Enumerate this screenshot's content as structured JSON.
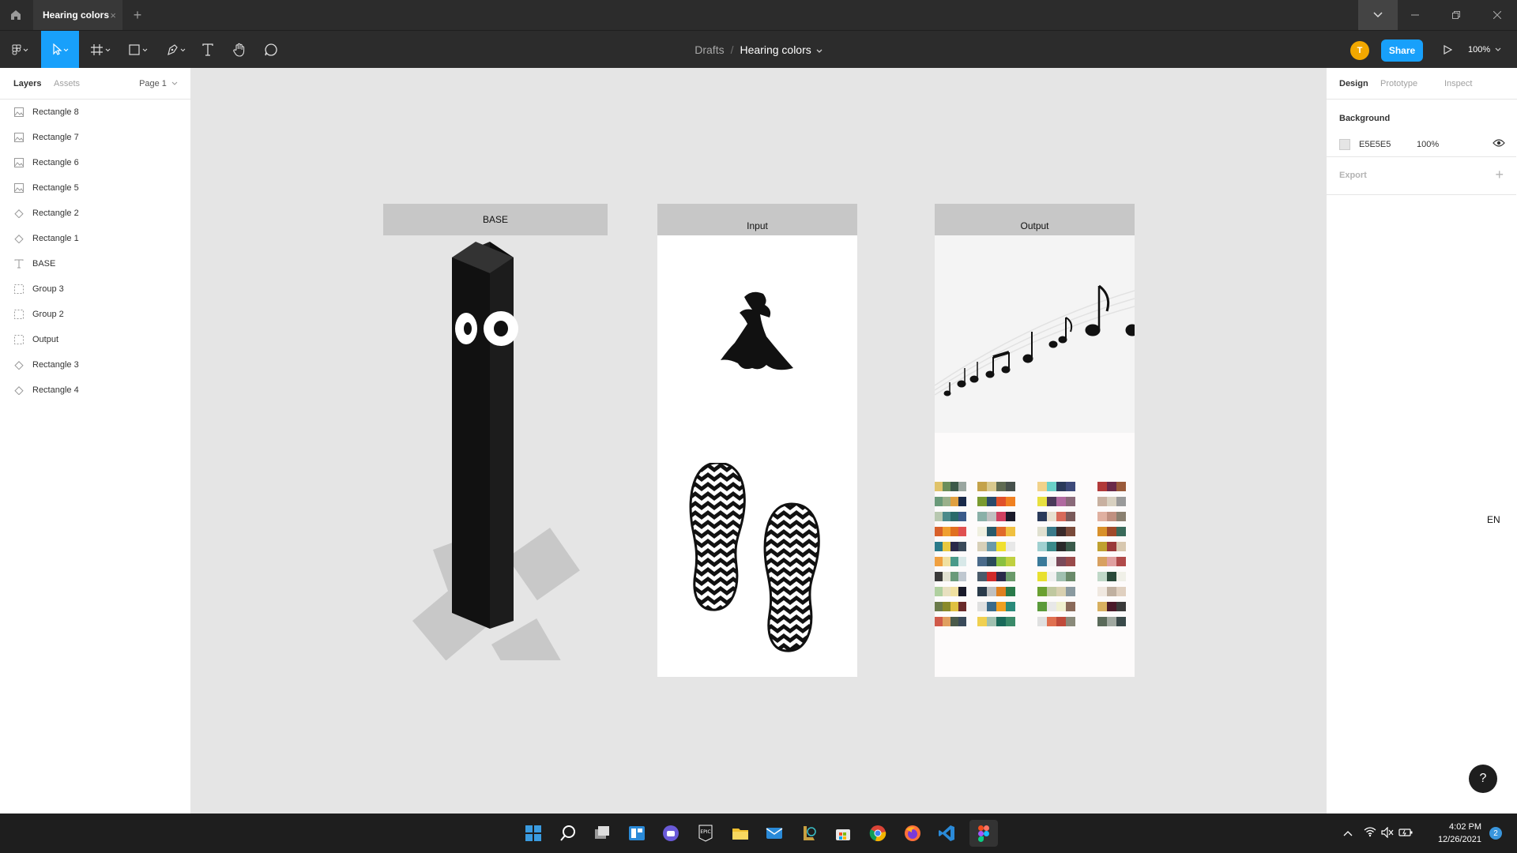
{
  "titlebar": {
    "tab_label": "Hearing colors",
    "tab_close": "×",
    "new_tab": "+"
  },
  "toolbar": {
    "breadcrumb_root": "Drafts",
    "breadcrumb_sep": "/",
    "file_name": "Hearing colors",
    "avatar_letter": "T",
    "share_label": "Share",
    "zoom_level": "100%"
  },
  "left_panel": {
    "tab_layers": "Layers",
    "tab_assets": "Assets",
    "page_select": "Page 1",
    "layers": [
      {
        "name": "Rectangle 8",
        "icon": "image-icon"
      },
      {
        "name": "Rectangle 7",
        "icon": "image-icon"
      },
      {
        "name": "Rectangle 6",
        "icon": "image-icon"
      },
      {
        "name": "Rectangle 5",
        "icon": "image-icon"
      },
      {
        "name": "Rectangle 2",
        "icon": "diamond-icon"
      },
      {
        "name": "Rectangle 1",
        "icon": "diamond-icon"
      },
      {
        "name": "BASE",
        "icon": "text-icon"
      },
      {
        "name": "Group 3",
        "icon": "group-icon"
      },
      {
        "name": "Group 2",
        "icon": "group-icon"
      },
      {
        "name": "Output",
        "icon": "group-icon"
      },
      {
        "name": "Rectangle 3",
        "icon": "diamond-icon"
      },
      {
        "name": "Rectangle 4",
        "icon": "diamond-icon"
      }
    ]
  },
  "right_panel": {
    "tab_design": "Design",
    "tab_prototype": "Prototype",
    "tab_inspect": "Inspect",
    "background_title": "Background",
    "background_hex": "E5E5E5",
    "background_opacity": "100%",
    "export_title": "Export",
    "export_add": "+"
  },
  "canvas": {
    "base_label": "BASE",
    "input_label": "Input",
    "output_label": "Output"
  },
  "ime": "EN",
  "help": "?",
  "taskbar": {
    "time": "4:02 PM",
    "date": "12/26/2021",
    "notifications": "2",
    "apps": [
      "start-icon",
      "search-icon",
      "task-view-icon",
      "widgets-icon",
      "teams-chat-icon",
      "epic-games-icon",
      "file-explorer-icon",
      "mail-icon",
      "league-icon",
      "store-icon",
      "chrome-icon",
      "firefox-icon",
      "vscode-icon",
      "figma-icon"
    ]
  },
  "colors": {
    "accent": "#18a0fb",
    "chrome_dark": "#2c2c2c",
    "canvas_bg": "#e5e5e5",
    "frame_header": "#c7c7c7"
  }
}
